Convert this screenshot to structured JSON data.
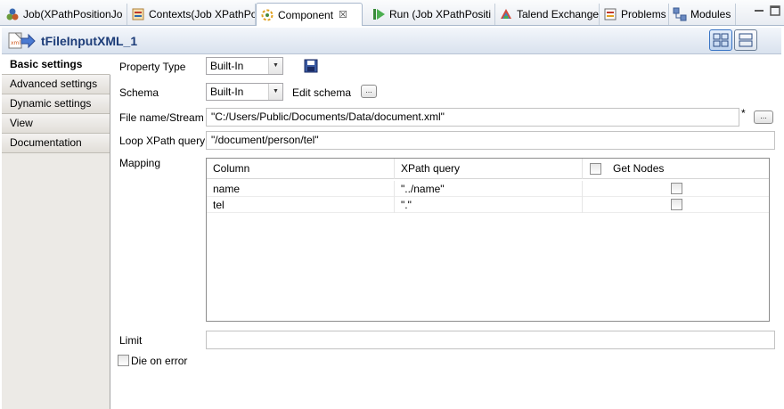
{
  "tabs": [
    {
      "label": "Job(XPathPositionJo",
      "icon": "job-icon"
    },
    {
      "label": "Contexts(Job XPathPo",
      "icon": "contexts-icon"
    },
    {
      "label": "Component",
      "icon": "component-icon",
      "active": true,
      "close": "☒"
    },
    {
      "label": "Run (Job XPathPositi",
      "icon": "run-icon"
    },
    {
      "label": "Talend Exchange",
      "icon": "exchange-icon"
    },
    {
      "label": "Problems",
      "icon": "problems-icon"
    },
    {
      "label": "Modules",
      "icon": "modules-icon"
    }
  ],
  "header": {
    "title": "tFileInputXML_1"
  },
  "nav": [
    {
      "label": "Basic settings",
      "active": true
    },
    {
      "label": "Advanced settings"
    },
    {
      "label": "Dynamic settings"
    },
    {
      "label": "View"
    },
    {
      "label": "Documentation"
    }
  ],
  "form": {
    "property_type_label": "Property Type",
    "property_type_value": "Built-In",
    "schema_label": "Schema",
    "schema_value": "Built-In",
    "edit_schema_label": "Edit schema",
    "file_name_label": "File name/Stream",
    "file_name_value": "\"C:/Users/Public/Documents/Data/document.xml\"",
    "file_required_mark": "*",
    "loop_label": "Loop XPath query",
    "loop_value": "\"/document/person/tel\"",
    "mapping_label": "Mapping",
    "limit_label": "Limit",
    "limit_value": "",
    "die_on_error_label": "Die on error",
    "dots": "..."
  },
  "mapping": {
    "columns": [
      "Column",
      "XPath query",
      "Get Nodes"
    ],
    "rows": [
      {
        "column": "name",
        "xpath": "\"../name\"",
        "get_nodes": false
      },
      {
        "column": "tel",
        "xpath": "\".\"",
        "get_nodes": false
      }
    ]
  },
  "colors": {
    "accent": "#1c3c78",
    "tab_border": "#a9b8cc"
  }
}
